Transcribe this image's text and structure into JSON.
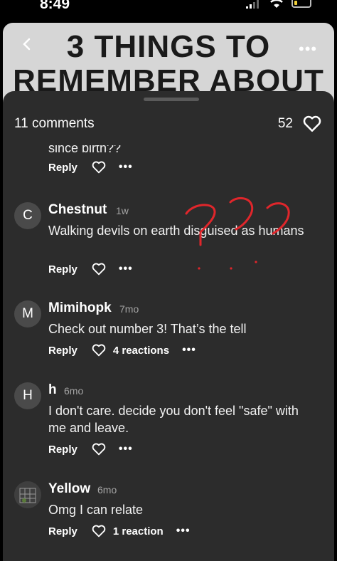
{
  "status": {
    "time": "8:49"
  },
  "header": {
    "title_lines": [
      "3 THINGS TO",
      "REMEMBER ABOUT"
    ]
  },
  "sheet": {
    "comments_count": "11 comments",
    "like_count": "52"
  },
  "comments": [
    {
      "partial_text": "since birth??",
      "reply": "Reply",
      "more": "•••"
    },
    {
      "avatar": "C",
      "name": "Chestnut",
      "time": "1w",
      "text": "Walking devils on earth disguised as humans",
      "reply": "Reply",
      "more": "•••"
    },
    {
      "avatar": "M",
      "name": "Mimihopk",
      "time": "7mo",
      "text": "Check out number 3! That’s the tell",
      "reply": "Reply",
      "reactions": "4 reactions",
      "more": "•••"
    },
    {
      "avatar": "H",
      "name": "h",
      "time": "6mo",
      "text": "I don't care. decide you don't feel \"safe\" with me and leave.",
      "reply": "Reply",
      "more": "•••"
    },
    {
      "name": "Yellow",
      "time": "6mo",
      "text": "Omg I can relate",
      "reply": "Reply",
      "reactions": "1 reaction",
      "more": "•••"
    }
  ],
  "colors": {
    "sheet_bg": "#2c2c2c",
    "scribble": "#e0262b",
    "header_bg": "#d6d6d6"
  }
}
